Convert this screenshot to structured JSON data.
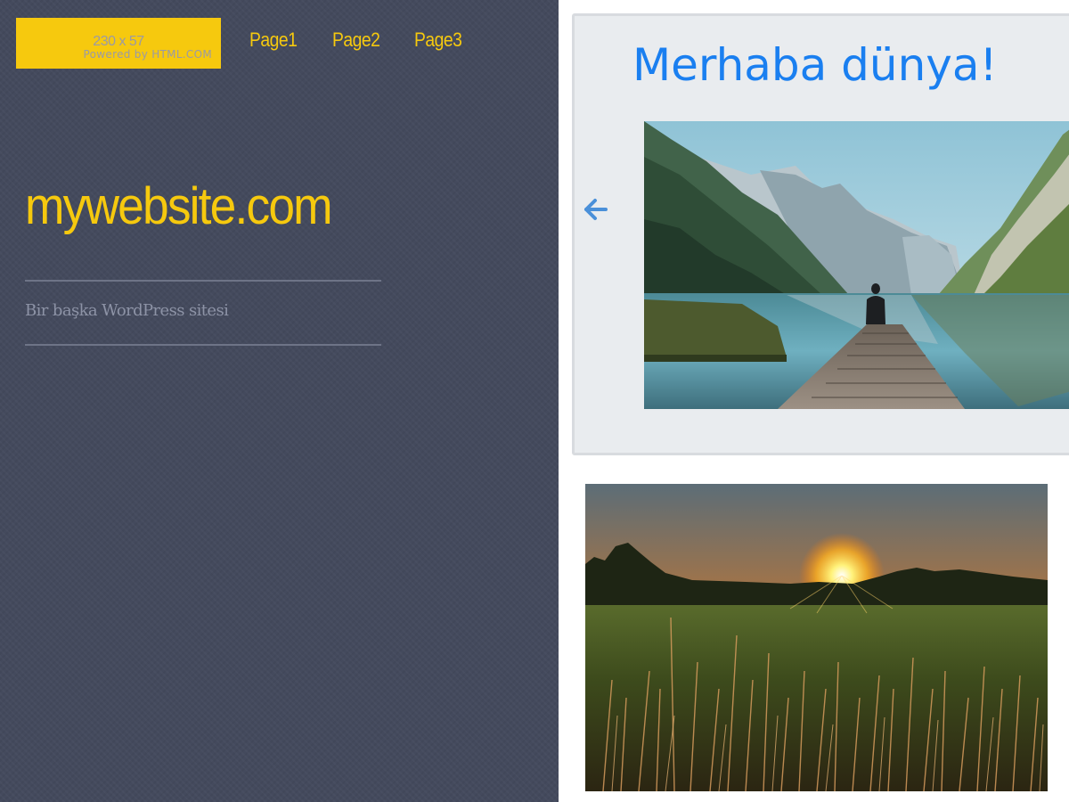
{
  "header": {
    "logo_placeholder": "230 x 57",
    "logo_powered_by": "Powered by HTML.COM",
    "nav": [
      {
        "label": "Page1"
      },
      {
        "label": "Page2"
      },
      {
        "label": "Page3"
      }
    ]
  },
  "site": {
    "title": "mywebsite.com",
    "tagline": "Bir başka WordPress sitesi"
  },
  "slider": {
    "heading": "Merhaba dünya!",
    "prev_icon": "arrow-left-icon",
    "image_description_icon": "mountain-lake-dock-photo"
  },
  "feature": {
    "image_icon": "sunset-field-photo"
  },
  "colors": {
    "sidebar_bg": "#444a5d",
    "accent_yellow": "#f6c90e",
    "heading_blue": "#1a7ff0",
    "card_bg": "#e9ecef",
    "arrow_blue": "#4a90d9"
  }
}
